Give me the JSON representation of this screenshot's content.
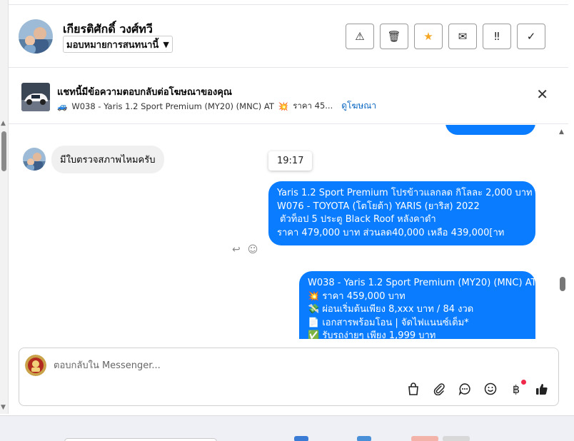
{
  "header": {
    "contact_name": "เกียรติศักดิ์ วงศ์ทวี",
    "assign_label": "มอบหมายการสนทนานี้",
    "actions": [
      {
        "name": "report-button",
        "icon": "warning-triangle-icon",
        "glyph": "⚠"
      },
      {
        "name": "delete-button",
        "icon": "trash-icon",
        "glyph": "🗑"
      },
      {
        "name": "star-button",
        "icon": "star-icon",
        "glyph": "★"
      },
      {
        "name": "mark-unread-button",
        "icon": "envelope-icon",
        "glyph": "✉"
      },
      {
        "name": "follow-up-button",
        "icon": "exclamation-icon",
        "glyph": "‼"
      },
      {
        "name": "mark-done-button",
        "icon": "check-icon",
        "glyph": "✓"
      }
    ]
  },
  "ad_banner": {
    "title": "แชทนี้มีข้อความตอบกลับต่อโฆษณาของคุณ",
    "car_emoji": "🚙",
    "ad_text": "W038 - Yaris 1.2 Sport Premium (MY20) (MNC) AT",
    "spark_emoji": "💥",
    "ad_price": "ราคา 45...",
    "view_ad_link": "ดูโฆษณา",
    "close_glyph": "✕"
  },
  "messages": {
    "incoming_text": "มีใบตรวจสภาพไหมครับ",
    "time_divider": "19:17",
    "outgoing_1": [
      "Yaris 1.2 Sport Premium โปรข้าวแลกลด กิโลละ 2,000 บาท",
      "W076 - TOYOTA (โตโยต้า) YARIS (ยาริส) 2022",
      " ",
      "ตัวท็อป 5 ประตู Black Roof หลังคาดำ",
      "ราคา 479,000 บาท ส่วนลด40,000 เหลือ 439,000[าท"
    ],
    "outgoing_2": [
      "W038 - Yaris 1.2 Sport Premium (MY20) (MNC) AT",
      "💥 ราคา 459,000 บาท",
      "💸 ผ่อนเริ่มต้นเพียง 8,xxx บาท / 84 งวด",
      "📄 เอกสารพร้อมโอน | จัดไฟแนนซ์เต็ม*",
      "✅ รับรถง่ายๆ เพียง 1,999 บาท"
    ],
    "reply_glyph": "↩",
    "react_glyph": "☺"
  },
  "composer": {
    "placeholder": "ตอบกลับใน Messenger...",
    "value": "",
    "icons": [
      {
        "name": "shopping-bag-icon",
        "glyph": "🛍"
      },
      {
        "name": "paperclip-icon",
        "glyph": "📎"
      },
      {
        "name": "saved-reply-icon",
        "glyph": "💬"
      },
      {
        "name": "emoji-icon",
        "glyph": "☺"
      },
      {
        "name": "baht-payment-icon",
        "glyph": "฿"
      },
      {
        "name": "thumbs-up-icon",
        "glyph": "👍"
      }
    ]
  },
  "colors": {
    "accent": "#0a7cff",
    "link": "#0a66c2",
    "star": "#f5a623",
    "notify_dot": "#f02849"
  }
}
